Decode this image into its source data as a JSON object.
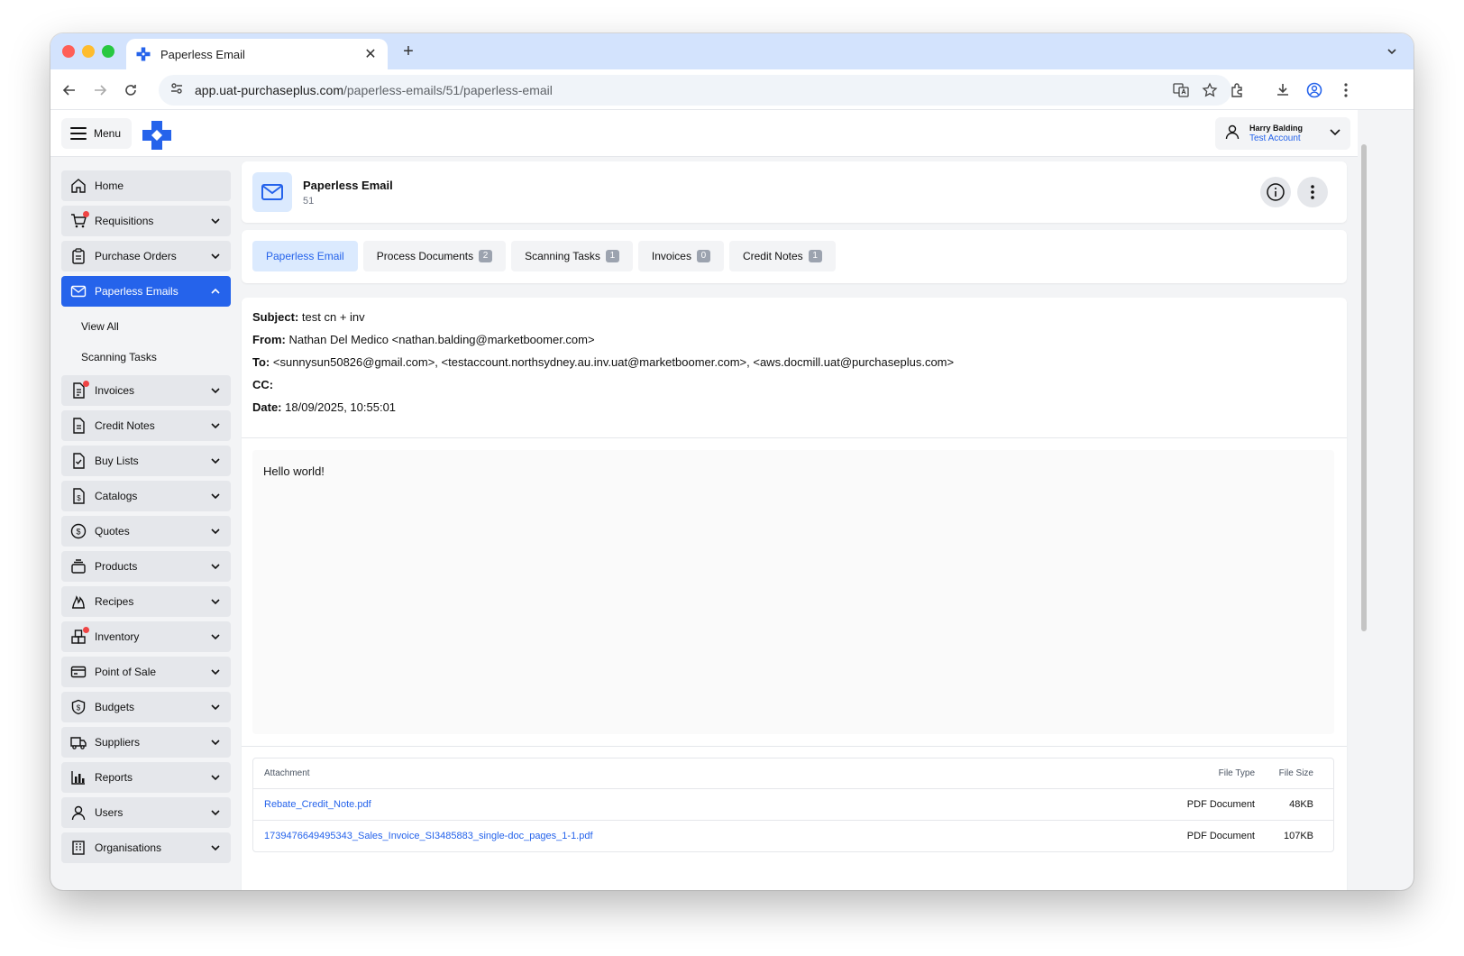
{
  "browser": {
    "tab_title": "Paperless Email",
    "new_tab_label": "+",
    "close_label": "✕",
    "url_host": "app.uat-purchaseplus.com",
    "url_path": "/paperless-emails/51/paperless-email"
  },
  "header": {
    "menu_label": "Menu",
    "user_name": "Harry Balding",
    "user_account": "Test Account"
  },
  "sidebar": {
    "items": [
      {
        "label": "Home",
        "icon": "home-icon"
      },
      {
        "label": "Requisitions",
        "icon": "cart-icon",
        "notification": true
      },
      {
        "label": "Purchase Orders",
        "icon": "clipboard-icon"
      },
      {
        "label": "Paperless Emails",
        "icon": "mail-icon",
        "active": true
      },
      {
        "label": "Invoices",
        "icon": "invoice-icon",
        "notification": true
      },
      {
        "label": "Credit Notes",
        "icon": "credit-note-icon"
      },
      {
        "label": "Buy Lists",
        "icon": "buy-list-icon"
      },
      {
        "label": "Catalogs",
        "icon": "catalog-icon"
      },
      {
        "label": "Quotes",
        "icon": "quote-icon"
      },
      {
        "label": "Products",
        "icon": "products-icon"
      },
      {
        "label": "Recipes",
        "icon": "recipe-icon"
      },
      {
        "label": "Inventory",
        "icon": "inventory-icon",
        "notification": true
      },
      {
        "label": "Point of Sale",
        "icon": "pos-icon"
      },
      {
        "label": "Budgets",
        "icon": "budget-icon"
      },
      {
        "label": "Suppliers",
        "icon": "truck-icon"
      },
      {
        "label": "Reports",
        "icon": "reports-icon"
      },
      {
        "label": "Users",
        "icon": "user-icon"
      },
      {
        "label": "Organisations",
        "icon": "organisation-icon"
      }
    ],
    "sub_items": [
      "View All",
      "Scanning Tasks"
    ]
  },
  "page": {
    "title": "Paperless Email",
    "subtitle": "51"
  },
  "tabs": [
    {
      "label": "Paperless Email",
      "active": true
    },
    {
      "label": "Process Documents",
      "count": "2"
    },
    {
      "label": "Scanning Tasks",
      "count": "1"
    },
    {
      "label": "Invoices",
      "count": "0"
    },
    {
      "label": "Credit Notes",
      "count": "1"
    }
  ],
  "email": {
    "subject_label": "Subject:",
    "subject": "test cn + inv",
    "from_label": "From:",
    "from": "Nathan Del Medico <nathan.balding@marketboomer.com>",
    "to_label": "To:",
    "to": "<sunnysun50826@gmail.com>, <testaccount.northsydney.au.inv.uat@marketboomer.com>, <aws.docmill.uat@purchaseplus.com>",
    "cc_label": "CC:",
    "cc": "",
    "date_label": "Date:",
    "date": "18/09/2025, 10:55:01",
    "body": "Hello world!"
  },
  "attachments": {
    "headers": {
      "name": "Attachment",
      "type": "File Type",
      "size": "File Size"
    },
    "rows": [
      {
        "name": "Rebate_Credit_Note.pdf",
        "type": "PDF Document",
        "size": "48KB"
      },
      {
        "name": "1739476649495343_Sales_Invoice_SI3485883_single-doc_pages_1-1.pdf",
        "type": "PDF Document",
        "size": "107KB"
      }
    ]
  },
  "colors": {
    "accent": "#2563eb",
    "notification": "#ef4444",
    "tab_strip": "#d3e3fd"
  }
}
